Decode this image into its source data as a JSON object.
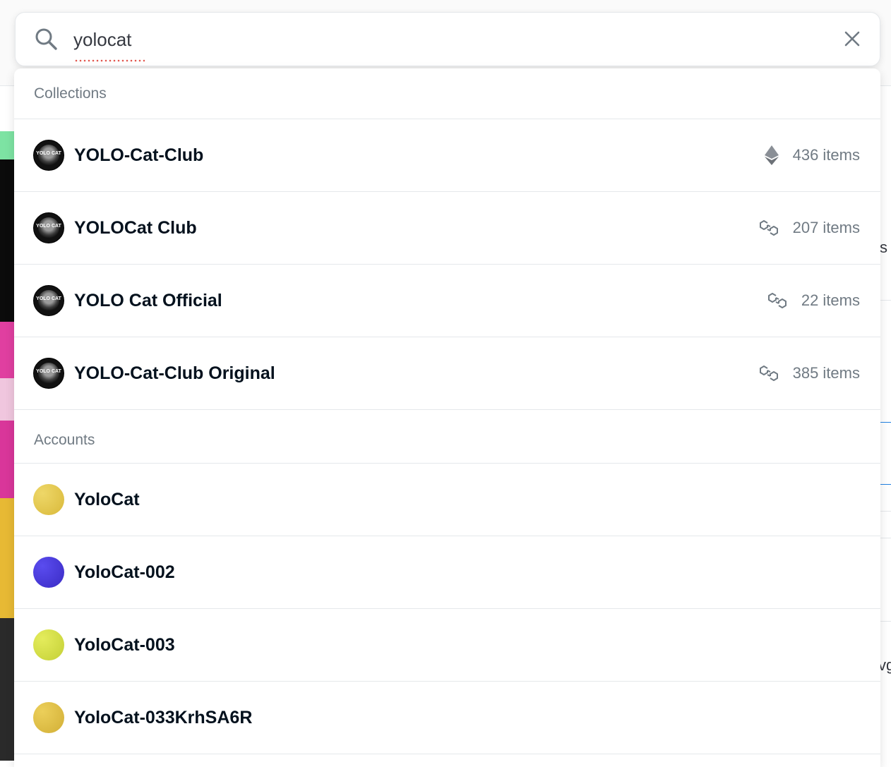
{
  "search": {
    "value": "yolocat",
    "placeholder": ""
  },
  "sections": {
    "collections_label": "Collections",
    "accounts_label": "Accounts"
  },
  "collections": [
    {
      "name": "YOLO-Cat-Club",
      "chain_icon": "ethereum-icon",
      "items": "436 items"
    },
    {
      "name": "YOLOCat Club",
      "chain_icon": "polygon-icon",
      "items": "207 items"
    },
    {
      "name": "YOLO Cat Official",
      "chain_icon": "polygon-icon",
      "items": "22 items"
    },
    {
      "name": "YOLO-Cat-Club Original",
      "chain_icon": "polygon-icon",
      "items": "385 items"
    }
  ],
  "collection_avatar_text": "YOLO CAT",
  "accounts": [
    {
      "name": "YoloCat",
      "avatar_color": "#e3c84b"
    },
    {
      "name": "YoloCat-002",
      "avatar_color": "#4b39d6"
    },
    {
      "name": "YoloCat-003",
      "avatar_color": "#d4e04a"
    },
    {
      "name": "YoloCat-033KrhSA6R",
      "avatar_color": "#e0c248"
    }
  ],
  "background": {
    "right_fragment_1": "s",
    "right_fragment_2": "vg"
  },
  "colors": {
    "text_primary": "#04111d",
    "text_secondary": "#707a83",
    "divider": "#e5e8eb"
  }
}
